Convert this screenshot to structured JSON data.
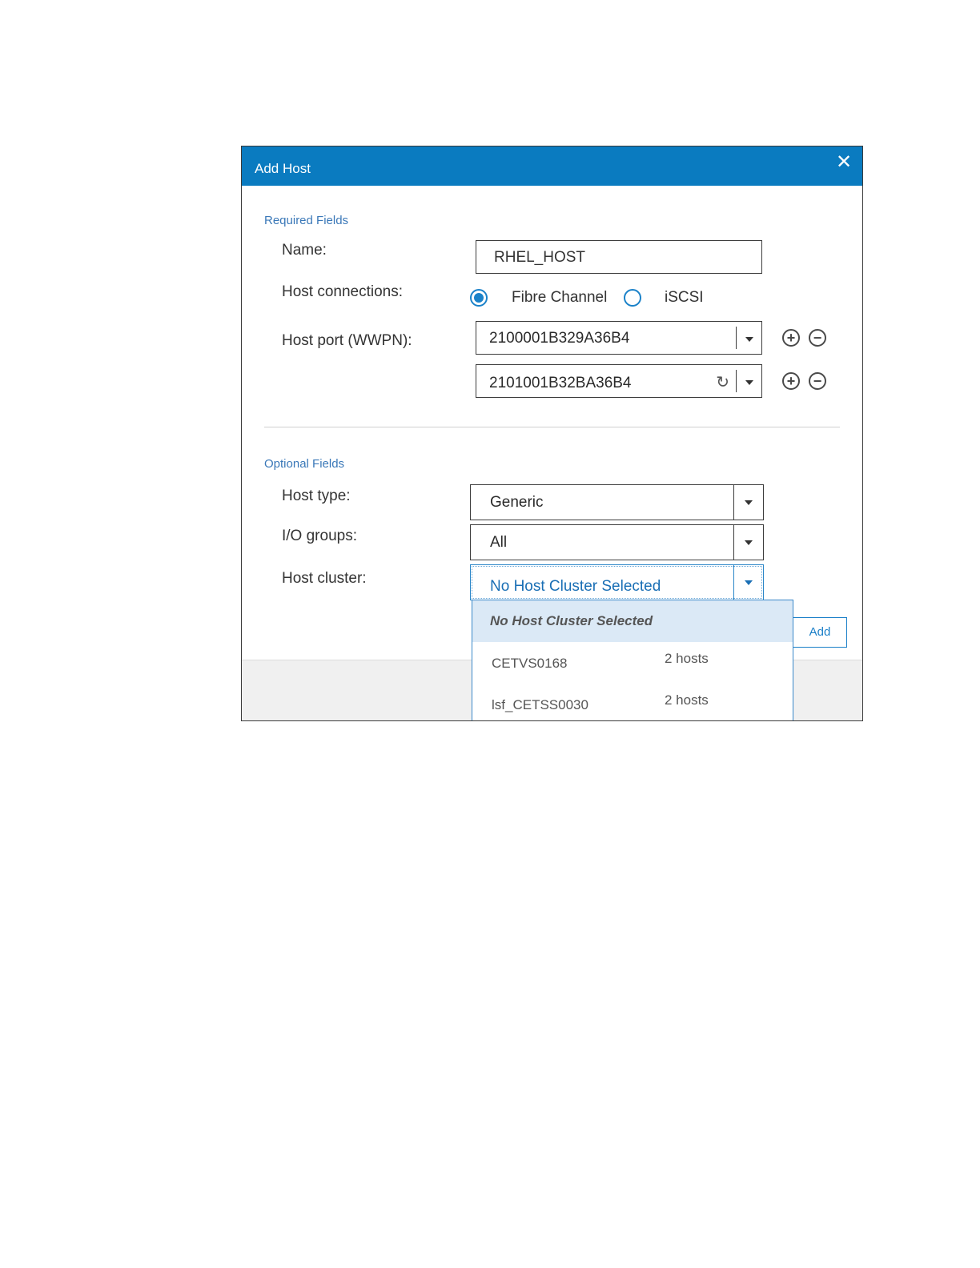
{
  "dialog": {
    "title": "Add Host",
    "close_icon": "close-icon"
  },
  "required": {
    "section_label": "Required Fields",
    "name_label": "Name:",
    "name_value": "RHEL_HOST",
    "connections_label": "Host connections:",
    "conn_option_fc": "Fibre Channel",
    "conn_option_iscsi": "iSCSI",
    "conn_selected": "Fibre Channel",
    "port_label": "Host port (WWPN):",
    "ports": [
      "2100001B329A36B4",
      "2101001B32BA36B4"
    ]
  },
  "optional": {
    "section_label": "Optional Fields",
    "host_type_label": "Host type:",
    "host_type_value": "Generic",
    "io_groups_label": "I/O groups:",
    "io_groups_value": "All",
    "host_cluster_label": "Host cluster:",
    "host_cluster_value": "No Host Cluster Selected"
  },
  "cluster_dropdown": {
    "selected_option": "No Host Cluster Selected",
    "options": [
      {
        "name": "CETVS0168",
        "count": "2 hosts"
      },
      {
        "name": "lsf_CETSS0030",
        "count": "2 hosts"
      }
    ]
  },
  "footer": {
    "add_label": "Add"
  },
  "colors": {
    "titlebar": "#0a7bc0",
    "accent": "#1b82c9",
    "section_label": "#3a78b8"
  }
}
